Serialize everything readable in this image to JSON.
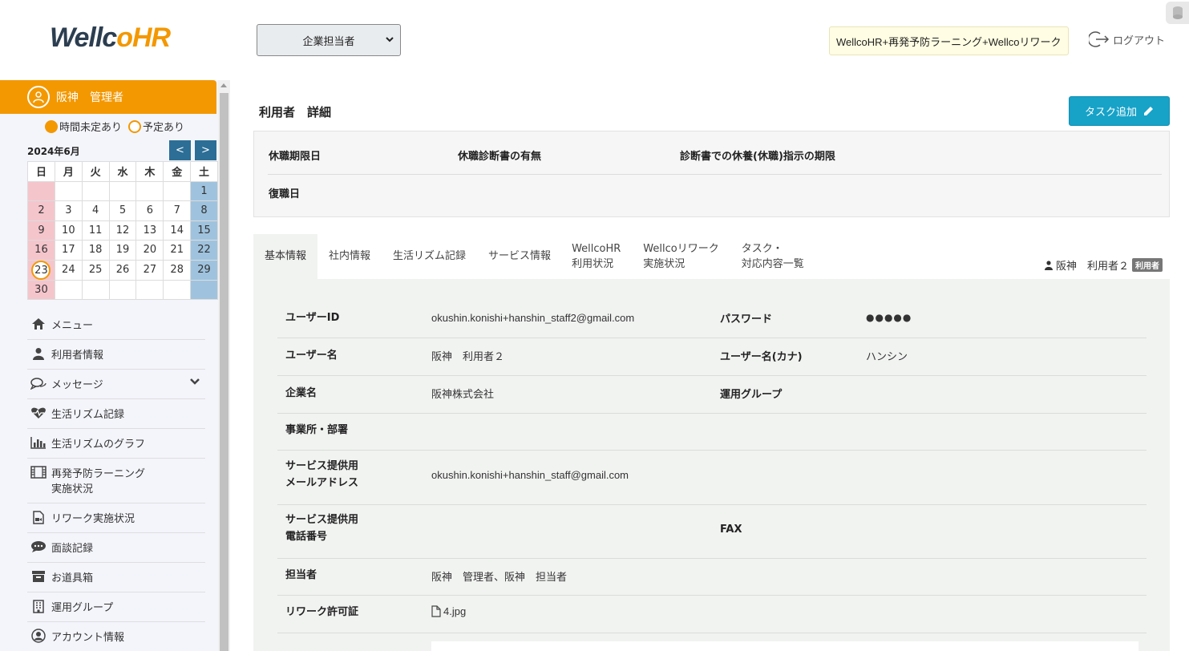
{
  "header": {
    "logo_w": "Wellc",
    "logo_o": "o",
    "logo_hr": "HR",
    "role_select": "企業担当者",
    "service_badge": "WellcoHR+再発予防ラーニング+Wellcoリワーク",
    "logout": "ログアウト"
  },
  "sidebar": {
    "user_name": "阪神　管理者",
    "legend_unscheduled": "時間未定あり",
    "legend_scheduled": "予定あり",
    "calendar": {
      "month": "2024年6月",
      "prev": "<",
      "next": ">",
      "weekdays": [
        "日",
        "月",
        "火",
        "水",
        "木",
        "金",
        "土"
      ],
      "weeks": [
        [
          "",
          "",
          "",
          "",
          "",
          "",
          "1"
        ],
        [
          "2",
          "3",
          "4",
          "5",
          "6",
          "7",
          "8"
        ],
        [
          "9",
          "10",
          "11",
          "12",
          "13",
          "14",
          "15"
        ],
        [
          "16",
          "17",
          "18",
          "19",
          "20",
          "21",
          "22"
        ],
        [
          "23",
          "24",
          "25",
          "26",
          "27",
          "28",
          "29"
        ],
        [
          "30",
          "",
          "",
          "",
          "",
          "",
          ""
        ]
      ],
      "today": "23"
    },
    "menu": [
      {
        "label": "メニュー",
        "icon": "home-icon"
      },
      {
        "label": "利用者情報",
        "icon": "user-icon"
      },
      {
        "label": "メッセージ",
        "icon": "chat-icon"
      },
      {
        "label": "生活リズム記録",
        "icon": "heartbeat-icon"
      },
      {
        "label": "生活リズムのグラフ",
        "icon": "bar-chart-icon"
      },
      {
        "label": "再発予防ラーニング\n実施状況",
        "icon": "film-icon"
      },
      {
        "label": "リワーク実施状況",
        "icon": "video-file-icon"
      },
      {
        "label": "面談記録",
        "icon": "comment-icon"
      },
      {
        "label": "お道具箱",
        "icon": "archive-icon"
      },
      {
        "label": "運用グループ",
        "icon": "building-icon"
      },
      {
        "label": "アカウント情報",
        "icon": "account-icon"
      }
    ]
  },
  "main": {
    "page_title": "利用者　詳細",
    "task_button": "タスク追加",
    "leave": {
      "leave_deadline": "休職期限日",
      "diagnosis_presence": "休職診断書の有無",
      "diagnosis_deadline": "診断書での休養(休職)指示の期限",
      "return_date": "復職日"
    },
    "tabs": [
      "基本情報",
      "社内情報",
      "生活リズム記録",
      "サービス情報",
      "WellcoHR\n利用状況",
      "Wellcoリワーク\n実施状況",
      "タスク・\n対応内容一覧"
    ],
    "current_user": "阪神　利用者２",
    "current_user_badge": "利用者",
    "info": {
      "user_id_label": "ユーザーID",
      "user_id": "okushin.konishi+hanshin_staff2@gmail.com",
      "password_label": "パスワード",
      "password": "●●●●●",
      "user_name_label": "ユーザー名",
      "user_name": "阪神　利用者２",
      "user_kana_label": "ユーザー名(カナ)",
      "user_kana": "ハンシン",
      "company_label": "企業名",
      "company": "阪神株式会社",
      "group_label": "運用グループ",
      "office_label": "事業所・部署",
      "service_email_label": "サービス提供用\nメールアドレス",
      "service_email": "okushin.konishi+hanshin_staff@gmail.com",
      "service_phone_label": "サービス提供用\n電話番号",
      "fax_label": "FAX",
      "staff_label": "担当者",
      "staff": "阪神　管理者、阪神　担当者",
      "permit_label": "リワーク許可証",
      "permit_file": "4.jpg"
    }
  }
}
